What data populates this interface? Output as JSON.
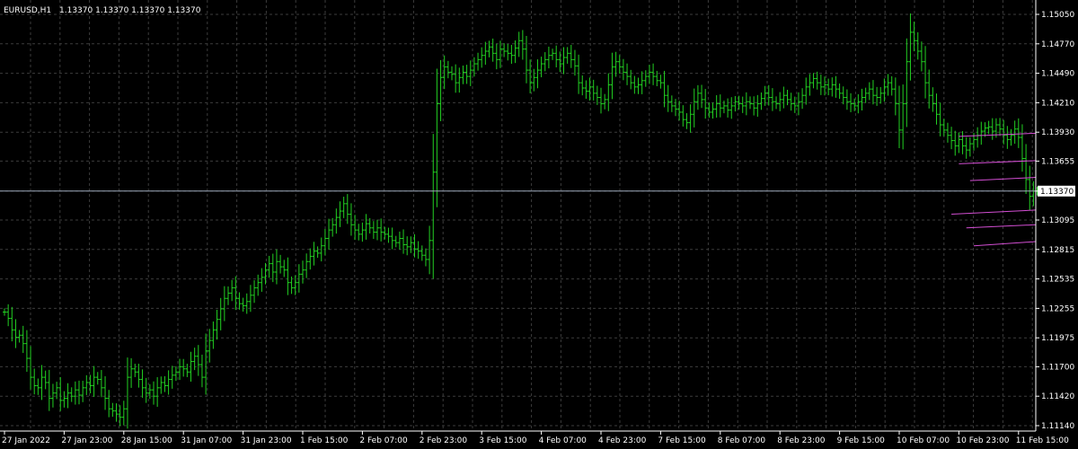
{
  "header": {
    "symbol": "EURUSD,H1",
    "ohlc": "1.13370 1.13370 1.13370 1.13370"
  },
  "current_price_label": "1.13370",
  "colors": {
    "background": "#000000",
    "grid": "#3c3c3c",
    "bars": "#22d022",
    "price_line": "#9aa6b8",
    "channel_lines": "#d24ed2",
    "axis": "#ffffff",
    "price_box": "#ffffff"
  },
  "chart_data": {
    "type": "ohlc-bar",
    "symbol": "EURUSD",
    "timeframe": "H1",
    "ylim": [
      1.1114,
      1.1505
    ],
    "y_ticks": [
      "1.15050",
      "1.14770",
      "1.14490",
      "1.14210",
      "1.13930",
      "1.13655",
      "1.13370",
      "1.13095",
      "1.12815",
      "1.12535",
      "1.12255",
      "1.11975",
      "1.11700",
      "1.11420",
      "1.11140"
    ],
    "x_ticks": [
      "27 Jan 2022",
      "27 Jan 23:00",
      "28 Jan 15:00",
      "31 Jan 07:00",
      "31 Jan 23:00",
      "1 Feb 15:00",
      "2 Feb 07:00",
      "2 Feb 23:00",
      "3 Feb 15:00",
      "4 Feb 07:00",
      "4 Feb 23:00",
      "7 Feb 15:00",
      "8 Feb 07:00",
      "8 Feb 23:00",
      "9 Feb 15:00",
      "10 Feb 07:00",
      "10 Feb 23:00",
      "11 Feb 15:00"
    ],
    "x_tick_index": [
      0,
      16,
      32,
      48,
      64,
      80,
      96,
      112,
      128,
      144,
      160,
      176,
      192,
      208,
      224,
      240,
      256,
      272
    ],
    "current_price": 1.1337,
    "closes": [
      1.1222,
      1.1216,
      1.1205,
      1.1198,
      1.12,
      1.1192,
      1.1178,
      1.116,
      1.1152,
      1.115,
      1.116,
      1.1155,
      1.114,
      1.1145,
      1.115,
      1.1138,
      1.114,
      1.1145,
      1.1142,
      1.1148,
      1.1143,
      1.115,
      1.1155,
      1.1152,
      1.116,
      1.1158,
      1.115,
      1.114,
      1.113,
      1.1128,
      1.1125,
      1.1122,
      1.113,
      1.116,
      1.1168,
      1.1165,
      1.1158,
      1.115,
      1.1145,
      1.1148,
      1.1142,
      1.115,
      1.1155,
      1.1152,
      1.1158,
      1.1162,
      1.1165,
      1.117,
      1.1168,
      1.1165,
      1.1175,
      1.118,
      1.1172,
      1.116,
      1.1185,
      1.1195,
      1.1205,
      1.1215,
      1.1225,
      1.1235,
      1.124,
      1.1245,
      1.1235,
      1.123,
      1.1228,
      1.1232,
      1.1238,
      1.1245,
      1.125,
      1.1255,
      1.1262,
      1.1268,
      1.126,
      1.127,
      1.1265,
      1.1262,
      1.125,
      1.1245,
      1.125,
      1.1258,
      1.1262,
      1.127,
      1.1275,
      1.128,
      1.1278,
      1.1285,
      1.1292,
      1.13,
      1.1305,
      1.1312,
      1.1318,
      1.1325,
      1.1315,
      1.1305,
      1.13,
      1.1296,
      1.13,
      1.1306,
      1.1302,
      1.1298,
      1.1302,
      1.1298,
      1.1296,
      1.1294,
      1.129,
      1.1288,
      1.1292,
      1.1286,
      1.1284,
      1.1288,
      1.1282,
      1.128,
      1.1276,
      1.1272,
      1.129,
      1.1355,
      1.142,
      1.1445,
      1.1455,
      1.145,
      1.1448,
      1.144,
      1.1445,
      1.145,
      1.1446,
      1.1452,
      1.1458,
      1.1462,
      1.1466,
      1.147,
      1.1474,
      1.1468,
      1.1462,
      1.1472,
      1.147,
      1.1468,
      1.1466,
      1.1473,
      1.148,
      1.1472,
      1.1452,
      1.144,
      1.1445,
      1.1452,
      1.1458,
      1.1462,
      1.1466,
      1.1468,
      1.1462,
      1.1458,
      1.1464,
      1.1468,
      1.1462,
      1.1456,
      1.144,
      1.1435,
      1.1432,
      1.1436,
      1.143,
      1.1426,
      1.142,
      1.1424,
      1.1438,
      1.1455,
      1.146,
      1.1455,
      1.145,
      1.1446,
      1.144,
      1.1436,
      1.1438,
      1.1442,
      1.1446,
      1.145,
      1.1446,
      1.1442,
      1.144,
      1.1428,
      1.1422,
      1.1418,
      1.1415,
      1.1412,
      1.1405,
      1.1402,
      1.141,
      1.1422,
      1.143,
      1.1424,
      1.1416,
      1.1412,
      1.1415,
      1.142,
      1.1416,
      1.1418,
      1.1414,
      1.1418,
      1.1422,
      1.142,
      1.1418,
      1.1422,
      1.142,
      1.1416,
      1.142,
      1.1425,
      1.143,
      1.1426,
      1.1422,
      1.142,
      1.1424,
      1.1428,
      1.1424,
      1.142,
      1.1418,
      1.1422,
      1.1428,
      1.1436,
      1.144,
      1.1444,
      1.144,
      1.1436,
      1.1438,
      1.1434,
      1.1438,
      1.1434,
      1.143,
      1.1426,
      1.1422,
      1.142,
      1.1418,
      1.1422,
      1.1426,
      1.143,
      1.1434,
      1.1428,
      1.1426,
      1.143,
      1.1436,
      1.144,
      1.1434,
      1.142,
      1.1395,
      1.142,
      1.146,
      1.1488,
      1.148,
      1.147,
      1.146,
      1.144,
      1.1428,
      1.142,
      1.141,
      1.14,
      1.1395,
      1.139,
      1.1385,
      1.138,
      1.1386,
      1.138,
      1.1376,
      1.1382,
      1.1386,
      1.139,
      1.1394,
      1.1397,
      1.1398,
      1.1394,
      1.14,
      1.1396,
      1.139,
      1.1386,
      1.139,
      1.1396,
      1.1388,
      1.1368,
      1.1348,
      1.1332,
      1.1337,
      1.1337
    ],
    "channel_lines": [
      {
        "from": [
          256,
          1.1389
        ],
        "to": [
          284,
          1.1392
        ]
      },
      {
        "from": [
          256,
          1.1363
        ],
        "to": [
          284,
          1.1366
        ]
      },
      {
        "from": [
          259,
          1.1347
        ],
        "to": [
          284,
          1.135
        ]
      },
      {
        "from": [
          254,
          1.1315
        ],
        "to": [
          284,
          1.1319
        ]
      },
      {
        "from": [
          258,
          1.1302
        ],
        "to": [
          284,
          1.1305
        ]
      },
      {
        "from": [
          260,
          1.1285
        ],
        "to": [
          284,
          1.1289
        ]
      }
    ]
  }
}
